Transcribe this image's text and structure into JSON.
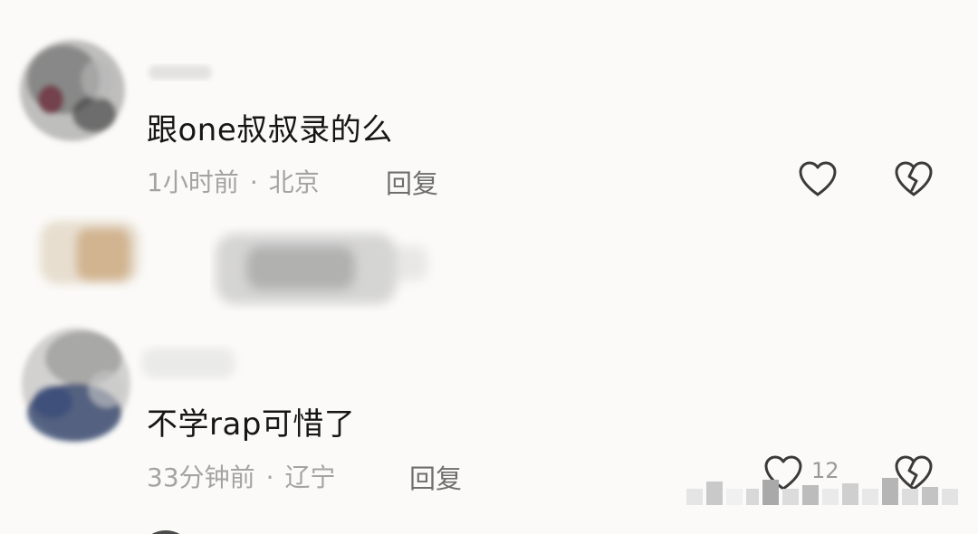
{
  "comments": [
    {
      "text": "跟one叔叔录的么",
      "time": "1小时前",
      "separator": "·",
      "location": "北京",
      "reply_label": "回复",
      "like_count": ""
    },
    {
      "text": "不学rap可惜了",
      "time": "33分钟前",
      "separator": "·",
      "location": "辽宁",
      "reply_label": "回复",
      "like_count": "12"
    }
  ],
  "icons": {
    "like": "heart-outline-icon",
    "dislike": "broken-heart-icon"
  },
  "colors": {
    "background": "#fbfaf8",
    "comment_text": "#161616",
    "meta_text": "#a3a3a3",
    "reply_text": "#6e6e6e",
    "icon_stroke": "#3a3a3a"
  }
}
